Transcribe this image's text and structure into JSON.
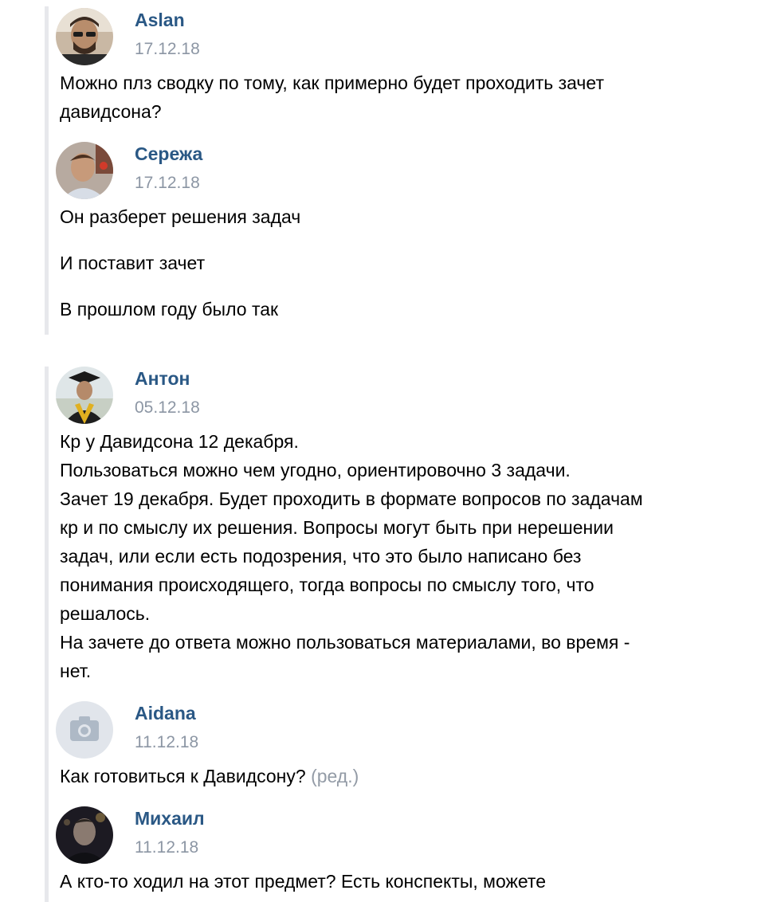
{
  "messages": [
    {
      "author": "Aslan",
      "date": "17.12.18",
      "avatar_icon": "user-photo-icon",
      "lines": [
        "Можно плз сводку по тому, как примерно будет проходить зачет",
        "давидсона?"
      ]
    },
    {
      "author": "Сережа",
      "date": "17.12.18",
      "avatar_icon": "user-photo-icon",
      "lines": [
        "Он разберет решения задач",
        "И поставит зачет",
        "В прошлом году было так"
      ]
    },
    {
      "author": "Антон",
      "date": "05.12.18",
      "avatar_icon": "user-photo-icon",
      "lines": [
        "Кр у Давидсона 12 декабря.",
        "Пользоваться можно чем угодно, ориентировочно 3 задачи.",
        "Зачет 19 декабря. Будет проходить в формате вопросов по задачам",
        "кр и по смыслу их решения. Вопросы могут быть при нерешении",
        "задач, или если есть подозрения, что это было написано без",
        "понимания происходящего, тогда вопросы по смыслу того, что",
        "решалось.",
        "На зачете до ответа можно пользоваться материалами, во время -",
        "нет."
      ]
    },
    {
      "author": "Aidana",
      "date": "11.12.18",
      "avatar_icon": "camera-icon",
      "text": "Как готовиться к Давидсону?",
      "edited_label": "(ред.)"
    },
    {
      "author": "Михаил",
      "date": "11.12.18",
      "avatar_icon": "user-photo-icon",
      "lines": [
        "А кто-то ходил на этот предмет? Есть конспекты, можете"
      ]
    }
  ],
  "colors": {
    "author": "#2a5885",
    "date": "#8c96a4",
    "quote_bar": "#e7e8ec",
    "edited": "#939ba6"
  }
}
